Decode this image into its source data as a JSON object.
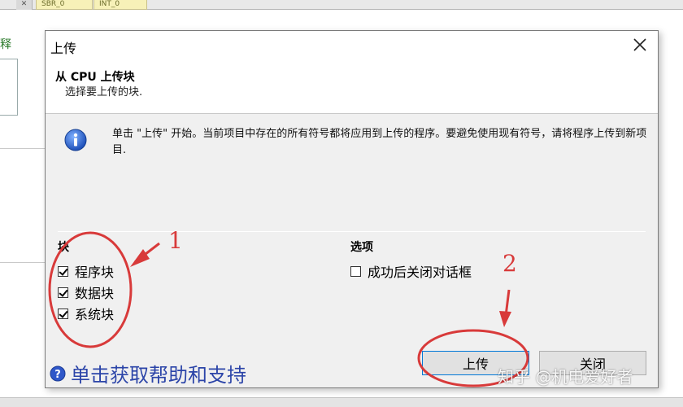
{
  "background": {
    "tabs": [
      "SBR_0",
      "INT_0"
    ],
    "left_label": "释"
  },
  "dialog": {
    "title": "上传",
    "header_title": "从 CPU 上传块",
    "header_subtitle": "选择要上传的块.",
    "info_text": "单击 \"上传\" 开始。当前项目中存在的所有符号都将应用到上传的程序。要避免使用现有符号，请将程序上传到新项目.",
    "blocks_group": {
      "label": "块",
      "items": [
        {
          "label": "程序块",
          "checked": true
        },
        {
          "label": "数据块",
          "checked": true
        },
        {
          "label": "系统块",
          "checked": true
        }
      ]
    },
    "options_group": {
      "label": "选项",
      "items": [
        {
          "label": "成功后关闭对话框",
          "checked": false
        }
      ]
    },
    "help_text": "单击获取帮助和支持",
    "buttons": {
      "upload": "上传",
      "close": "关闭"
    }
  },
  "annotations": {
    "marker_1": "1",
    "marker_2": "2",
    "color": "#d83a3a"
  },
  "watermark": "知乎 @机电爱好者"
}
